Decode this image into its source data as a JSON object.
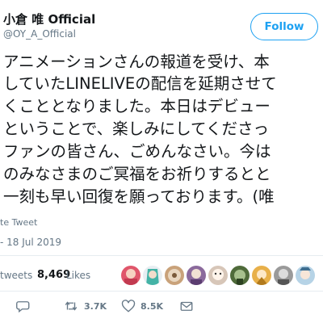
{
  "header": {
    "display_name": "小倉 唯 Official",
    "handle": "@OY_A_Official",
    "follow_label": "Follow"
  },
  "tweet": {
    "lines": [
      "アニメーションさんの報道を受け、本",
      "していたLINELIVEの配信を延期させて",
      "くこととなりました。本日はデビュー",
      "ということで、楽しみにしてくださっ",
      "ファンの皆さん、ごめんなさい。今は",
      "のみなさまのご冥福をお祈りするとと",
      "一刻も早い回復を願っております。(唯"
    ],
    "translate_label": "te Tweet",
    "timestamp": "- 18 Jul 2019"
  },
  "stats": {
    "retweets_label": "tweets",
    "likes_count": "8,469",
    "likes_label": "Likes"
  },
  "avatars": [
    {
      "name": "avatar-1",
      "color": "#e0566b"
    },
    {
      "name": "avatar-2",
      "color": "#44b3a6"
    },
    {
      "name": "avatar-3",
      "color": "#c9a27a"
    },
    {
      "name": "avatar-4",
      "color": "#8b6a9c"
    },
    {
      "name": "avatar-5",
      "color": "#d7c6b8"
    },
    {
      "name": "avatar-6",
      "color": "#4f6b3a"
    },
    {
      "name": "avatar-7",
      "color": "#e8b04a"
    },
    {
      "name": "avatar-8",
      "color": "#9a9a9a"
    },
    {
      "name": "avatar-9",
      "color": "#b6d3e6"
    },
    {
      "name": "avatar-10",
      "color": "#6b4b3a"
    }
  ],
  "actions": {
    "retweet_count": "3.7K",
    "like_count": "8.5K"
  },
  "colors": {
    "accent": "#1da1f2",
    "muted": "#657786",
    "divider": "#e6ecf0",
    "text": "#14171a"
  }
}
